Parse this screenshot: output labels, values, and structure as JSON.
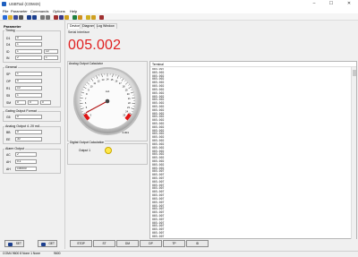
{
  "window": {
    "title": "USBTool (COM4X)",
    "minimize": "–",
    "maximize": "☐",
    "close": "✕"
  },
  "menu": [
    "File",
    "Parameter",
    "Commands",
    "Options",
    "Help"
  ],
  "toolbar": {
    "icons": [
      {
        "name": "new-icon",
        "color": "#2b6cd8"
      },
      {
        "name": "open-icon",
        "color": "#e0b030"
      },
      {
        "name": "save-icon",
        "color": "#3a4a9a"
      },
      {
        "name": "print-icon",
        "color": "#555555"
      },
      {
        "name": "connect-icon",
        "color": "#1b3f8f"
      },
      {
        "name": "disconnect-icon",
        "color": "#1b3f8f"
      },
      {
        "name": "copy-icon",
        "color": "#777777"
      },
      {
        "name": "paste-icon",
        "color": "#777777"
      },
      {
        "name": "settings-icon",
        "color": "#a23030"
      },
      {
        "name": "ok-icon",
        "color": "#3a3a8a"
      },
      {
        "name": "info-icon",
        "color": "#d0a020"
      },
      {
        "name": "download-icon",
        "color": "#208040"
      },
      {
        "name": "upload-icon",
        "color": "#d09020"
      },
      {
        "name": "bulb-icon",
        "color": "#d0b020"
      },
      {
        "name": "help-icon",
        "color": "#d0a020"
      },
      {
        "name": "exit-icon",
        "color": "#a03030"
      }
    ]
  },
  "left": {
    "heading": "Parameter",
    "timing": {
      "title": "Timing",
      "fields": [
        {
          "label": "D1",
          "value": "0"
        },
        {
          "label": "D4",
          "value": "1"
        },
        {
          "label": "ID",
          "value": "1",
          "extra": "10"
        },
        {
          "label": "IN",
          "value": "2",
          "extra": "1"
        }
      ]
    },
    "general": {
      "title": "General",
      "fields": [
        {
          "label": "SP",
          "value": "1"
        },
        {
          "label": "OP",
          "value": "0"
        },
        {
          "label": "R1",
          "value": "10"
        },
        {
          "label": "S5",
          "value": "1"
        }
      ],
      "triple": {
        "label": "SM",
        "values": [
          "0",
          "0",
          "0"
        ]
      }
    },
    "gating": {
      "title": "Gating Output Format",
      "fields": [
        {
          "label": "G5",
          "value": "0"
        }
      ]
    },
    "analog": {
      "title": "Analog Output 4..20 mA",
      "fields": [
        {
          "label": "BB",
          "value": "0"
        },
        {
          "label": "EE",
          "value": "30"
        }
      ]
    },
    "alarm": {
      "title": "Alarm Output",
      "fields": [
        {
          "label": "AC",
          "value": "2"
        },
        {
          "label": "AH",
          "value": "0.1"
        },
        {
          "label": "AH",
          "value": "100000"
        }
      ]
    },
    "btn_set": "SET",
    "btn_get": "GET"
  },
  "tabs": [
    "Device",
    "Diagram",
    "Log Window"
  ],
  "serial": {
    "label": "Serial Interface",
    "value": "005.002"
  },
  "analog_box": {
    "title": "Analog Output Calculator",
    "unit": "mA",
    "readout": "4.001",
    "ticks": [
      "3",
      "4",
      "5",
      "6",
      "7",
      "8",
      "9",
      "10",
      "11",
      "12",
      "13",
      "14",
      "15",
      "16",
      "17",
      "18",
      "19",
      "20",
      "21",
      "22",
      "23",
      "24",
      "25"
    ]
  },
  "digital_box": {
    "title": "Digital Output Calculation",
    "output_label": "Output 1",
    "led_color": "#ffe84a"
  },
  "terminal": {
    "title": "Terminal",
    "lines": [
      "005.007",
      "005.002",
      "005.002",
      "005.002",
      "005.002",
      "005.002",
      "005.002",
      "005.002",
      "005.002",
      "005.002",
      "005.002",
      "005.002",
      "005.002",
      "005.002",
      "005.002",
      "005.002",
      "005.002",
      "005.002",
      "005.002",
      "005.002",
      "005.002",
      "005.002",
      "005.002",
      "005.002",
      "005.002",
      "005.002",
      "005.002",
      "005.002",
      "005.002",
      "005.002",
      "005.007",
      "005.007",
      "005.007",
      "005.007",
      "005.007",
      "005.007",
      "005.007",
      "005.007",
      "005.007",
      "005.007",
      "005.007",
      "005.007",
      "005.007",
      "005.007",
      "005.007",
      "005.007",
      "005.007",
      "005.007",
      "005.007",
      "005.007"
    ]
  },
  "commands": [
    "STOP",
    "ST",
    "DM",
    "DP",
    "TP",
    "ID"
  ],
  "status": {
    "text": "COM4 9600 8 None 1 None",
    "baud": "9600"
  }
}
